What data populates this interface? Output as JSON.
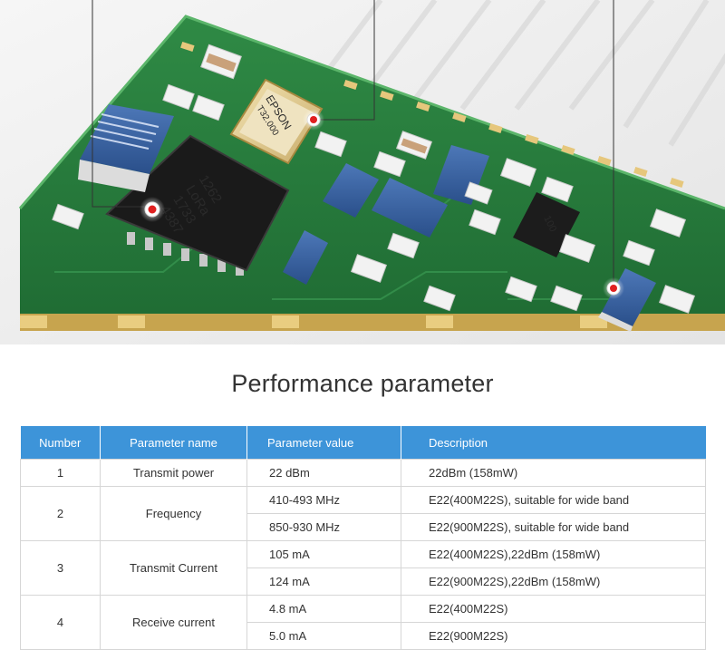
{
  "hero": {
    "crystal_brand": "EPSON",
    "crystal_code": "T32.000",
    "chip_part": "1262",
    "chip_name": "LoRa",
    "chip_lot1": "1733",
    "chip_lot2": "4387",
    "amp_marking": "100"
  },
  "section_title": "Performance parameter",
  "table": {
    "headers": [
      "Number",
      "Parameter name",
      "Parameter value",
      "Description"
    ],
    "rows": [
      {
        "number": "1",
        "name": "Transmit power",
        "entries": [
          {
            "value": "22 dBm",
            "description": "22dBm (158mW)"
          }
        ]
      },
      {
        "number": "2",
        "name": "Frequency",
        "entries": [
          {
            "value": "410-493 MHz",
            "description": "E22(400M22S), suitable for wide band"
          },
          {
            "value": "850-930 MHz",
            "description": "E22(900M22S), suitable for wide band"
          }
        ]
      },
      {
        "number": "3",
        "name": "Transmit Current",
        "entries": [
          {
            "value": "105 mA",
            "description": "E22(400M22S),22dBm (158mW)"
          },
          {
            "value": "124 mA",
            "description": "E22(900M22S),22dBm (158mW)"
          }
        ]
      },
      {
        "number": "4",
        "name": "Receive current",
        "entries": [
          {
            "value": "4.8 mA",
            "description": "E22(400M22S)"
          },
          {
            "value": "5.0 mA",
            "description": "E22(900M22S)"
          }
        ]
      }
    ]
  }
}
